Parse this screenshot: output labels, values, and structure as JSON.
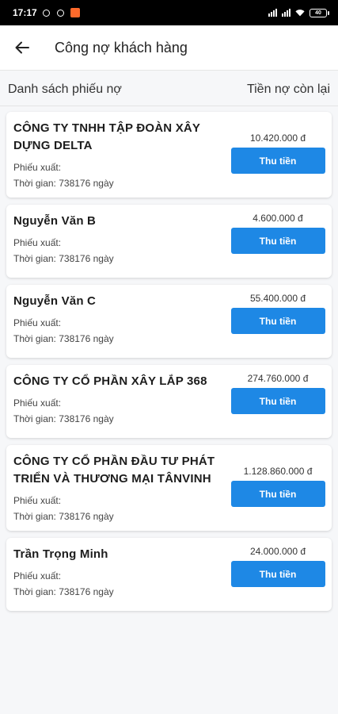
{
  "status": {
    "time": "17:17",
    "battery": "40"
  },
  "header": {
    "title": "Công nợ khách hàng"
  },
  "list_header": {
    "left": "Danh sách phiếu nợ",
    "right": "Tiền nợ còn lại"
  },
  "labels": {
    "voucher": "Phiếu xuất:",
    "pay_button": "Thu tiền"
  },
  "debts": [
    {
      "name": "CÔNG TY TNHH TẬP ĐOÀN XÂY DỰNG DELTA",
      "time": "Thời gian: 738176 ngày",
      "amount": "10.420.000 đ"
    },
    {
      "name": "Nguyễn Văn B",
      "time": "Thời gian: 738176 ngày",
      "amount": "4.600.000 đ"
    },
    {
      "name": "Nguyễn Văn C",
      "time": "Thời gian: 738176 ngày",
      "amount": "55.400.000 đ"
    },
    {
      "name": "CÔNG TY CỔ PHẦN XÂY LẮP 368",
      "time": "Thời gian: 738176 ngày",
      "amount": "274.760.000 đ"
    },
    {
      "name": "CÔNG TY CỔ PHẦN ĐẦU TƯ PHÁT TRIỂN VÀ THƯƠNG MẠI TÂNVINH",
      "time": "Thời gian: 738176 ngày",
      "amount": "1.128.860.000 đ"
    },
    {
      "name": "Trần Trọng Minh",
      "time": "Thời gian: 738176 ngày",
      "amount": "24.000.000 đ"
    }
  ],
  "colors": {
    "accent": "#1e88e5",
    "status_bar": "#000000"
  }
}
